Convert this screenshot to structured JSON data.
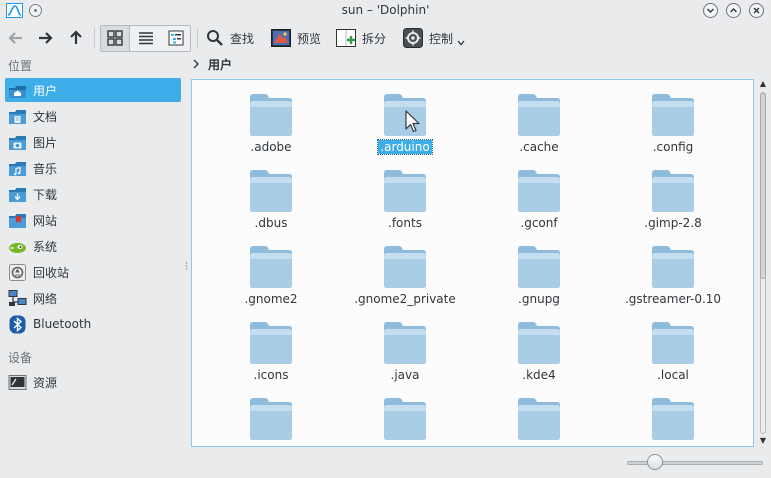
{
  "window": {
    "title": "sun – 'Dolphin'"
  },
  "toolbar": {
    "find_label": "查找",
    "preview_label": "预览",
    "split_label": "拆分",
    "control_label": "控制"
  },
  "sidebar": {
    "places_header": "位置",
    "devices_header": "设备",
    "places": [
      {
        "label": "用户",
        "icon": "home-icon"
      },
      {
        "label": "文档",
        "icon": "documents-icon"
      },
      {
        "label": "图片",
        "icon": "pictures-icon"
      },
      {
        "label": "音乐",
        "icon": "music-icon"
      },
      {
        "label": "下载",
        "icon": "downloads-icon"
      },
      {
        "label": "网站",
        "icon": "website-icon"
      },
      {
        "label": "系统",
        "icon": "system-icon"
      },
      {
        "label": "回收站",
        "icon": "trash-icon"
      },
      {
        "label": "网络",
        "icon": "network-icon"
      },
      {
        "label": "Bluetooth",
        "icon": "bluetooth-icon"
      }
    ],
    "devices": [
      {
        "label": "资源",
        "icon": "drive-icon"
      }
    ]
  },
  "breadcrumb": {
    "current": "用户"
  },
  "files": [
    ".adobe",
    ".arduino",
    ".cache",
    ".config",
    ".dbus",
    ".fonts",
    ".gconf",
    ".gimp-2.8",
    ".gnome2",
    ".gnome2_private",
    ".gnupg",
    ".gstreamer-0.10",
    ".icons",
    ".java",
    ".kde4",
    ".local",
    "",
    "",
    "",
    ""
  ],
  "selected_file": ".arduino",
  "colors": {
    "accent": "#3daee9",
    "folder": "#a9cde6"
  }
}
